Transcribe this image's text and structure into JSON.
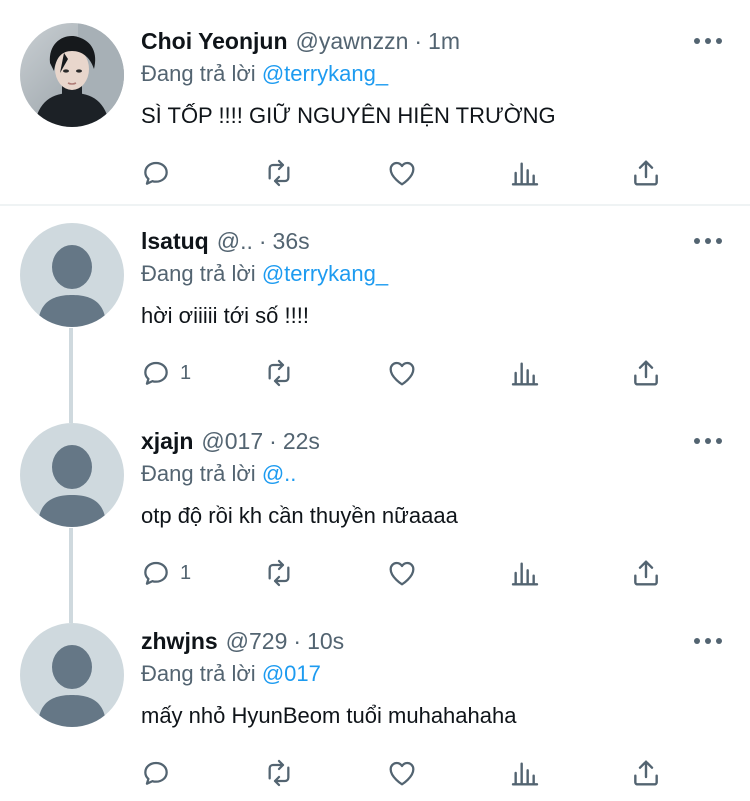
{
  "labels": {
    "reply_prefix": "Đang trả lời"
  },
  "tweets": [
    {
      "name": "Choi Yeonjun",
      "handle": "@yawnzzn",
      "separator": "·",
      "time": "1m",
      "reply_to": "@terrykang_",
      "text": "SÌ TỐP !!!! GIỮ NGUYÊN HIỆN TRƯỜNG",
      "reply_count": "",
      "avatar": "photo"
    },
    {
      "name": "lsatuq",
      "handle": "@..",
      "separator": "·",
      "time": "36s",
      "reply_to": "@terrykang_",
      "text": "hời ơiiiii tới số !!!!",
      "reply_count": "1",
      "avatar": "default"
    },
    {
      "name": "xjajn",
      "handle": "@017",
      "separator": "·",
      "time": "22s",
      "reply_to": "@..",
      "text": "otp độ rồi kh cần thuyền nữaaaa",
      "reply_count": "1",
      "avatar": "default"
    },
    {
      "name": "zhwjns",
      "handle": "@729",
      "separator": "·",
      "time": "10s",
      "reply_to": "@017",
      "text": "mấy nhỏ HyunBeom tuổi muhahahaha",
      "reply_count": "",
      "avatar": "default"
    }
  ],
  "icons": {
    "reply": "reply-icon",
    "retweet": "retweet-icon",
    "like": "heart-icon",
    "views": "analytics-icon",
    "share": "share-icon",
    "more": "more-icon"
  },
  "colors": {
    "text": "#0f1419",
    "secondary": "#536471",
    "link": "#1d9bf0",
    "thread_line": "#cfd9de",
    "avatar_bg": "#cfd9de",
    "avatar_silhouette": "#657786"
  }
}
